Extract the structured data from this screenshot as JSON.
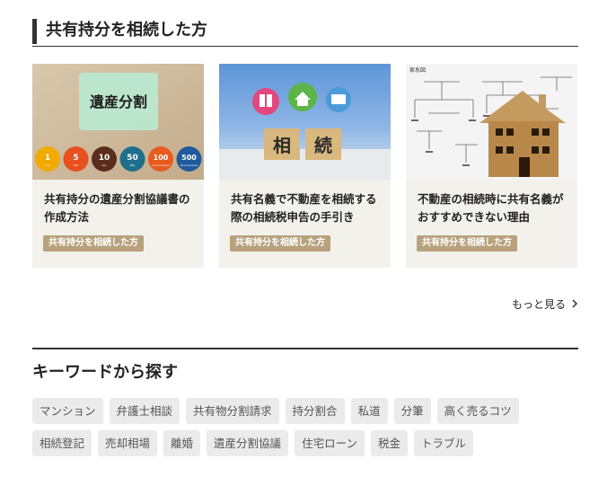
{
  "section": {
    "title": "共有持分を相続した方",
    "cards": [
      {
        "title": "共有持分の遺産分割協議書の作成方法",
        "tag": "共有持分を相続した方",
        "image_text": "遺産分割",
        "coins": [
          {
            "value": "1",
            "sub": "one",
            "color": "#f2a900"
          },
          {
            "value": "5",
            "sub": "five",
            "color": "#e8501e"
          },
          {
            "value": "10",
            "sub": "ten",
            "color": "#5a2d1e"
          },
          {
            "value": "50",
            "sub": "fifty",
            "color": "#1e6f8c"
          },
          {
            "value": "100",
            "sub": "one hundred",
            "color": "#e85a1e"
          },
          {
            "value": "500",
            "sub": "five hundred",
            "color": "#1e5a9c"
          }
        ]
      },
      {
        "title": "共有名義で不動産を相続する際の相続税申告の手引き",
        "tag": "共有持分を相続した方",
        "image_chars": [
          "相",
          "続"
        ]
      },
      {
        "title": "不動産の相続時に共有名義がおすすめできない理由",
        "tag": "共有持分を相続した方",
        "image_text": "家系図"
      }
    ],
    "more_label": "もっと見る"
  },
  "keywords": {
    "title": "キーワードから探す",
    "row1": [
      "マンション",
      "弁護士相談",
      "共有物分割請求",
      "持分割合",
      "私道",
      "分筆",
      "高く売るコツ"
    ],
    "row2": [
      "相続登記",
      "売却相場",
      "離婚",
      "遺産分割協議",
      "住宅ローン",
      "税金",
      "トラブル"
    ]
  }
}
